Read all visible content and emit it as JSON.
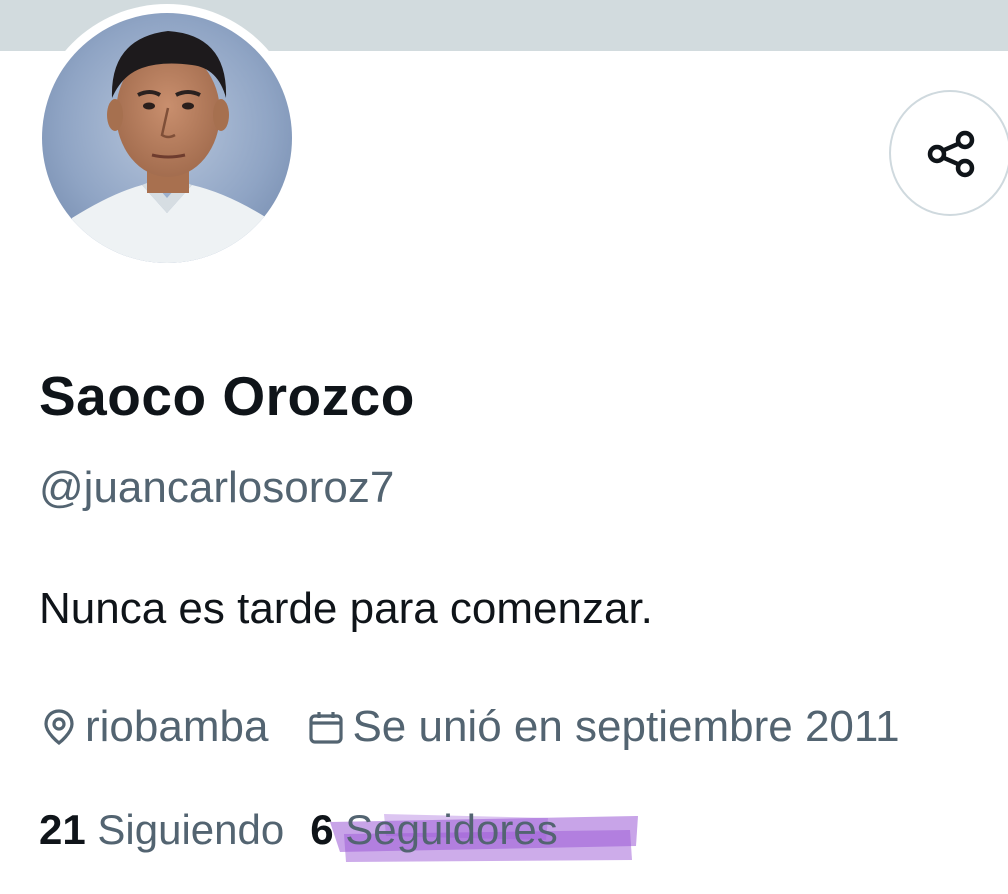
{
  "profile": {
    "display_name": "Saoco Orozco",
    "handle": "@juancarlosoroz7",
    "bio": "Nunca es tarde para comenzar.",
    "location": "riobamba",
    "joined": "Se unió en septiembre 2011",
    "following_count": "21",
    "following_label": "Siguiendo",
    "followers_count": "6",
    "followers_label": "Seguidores"
  },
  "icons": {
    "share": "share-icon",
    "location": "location-pin-icon",
    "calendar": "calendar-icon"
  },
  "colors": {
    "banner": "#d2dbde",
    "primary_text": "#0f1419",
    "secondary_text": "#536471",
    "border": "#cfd9de",
    "highlight_marker": "#9b59d6"
  }
}
